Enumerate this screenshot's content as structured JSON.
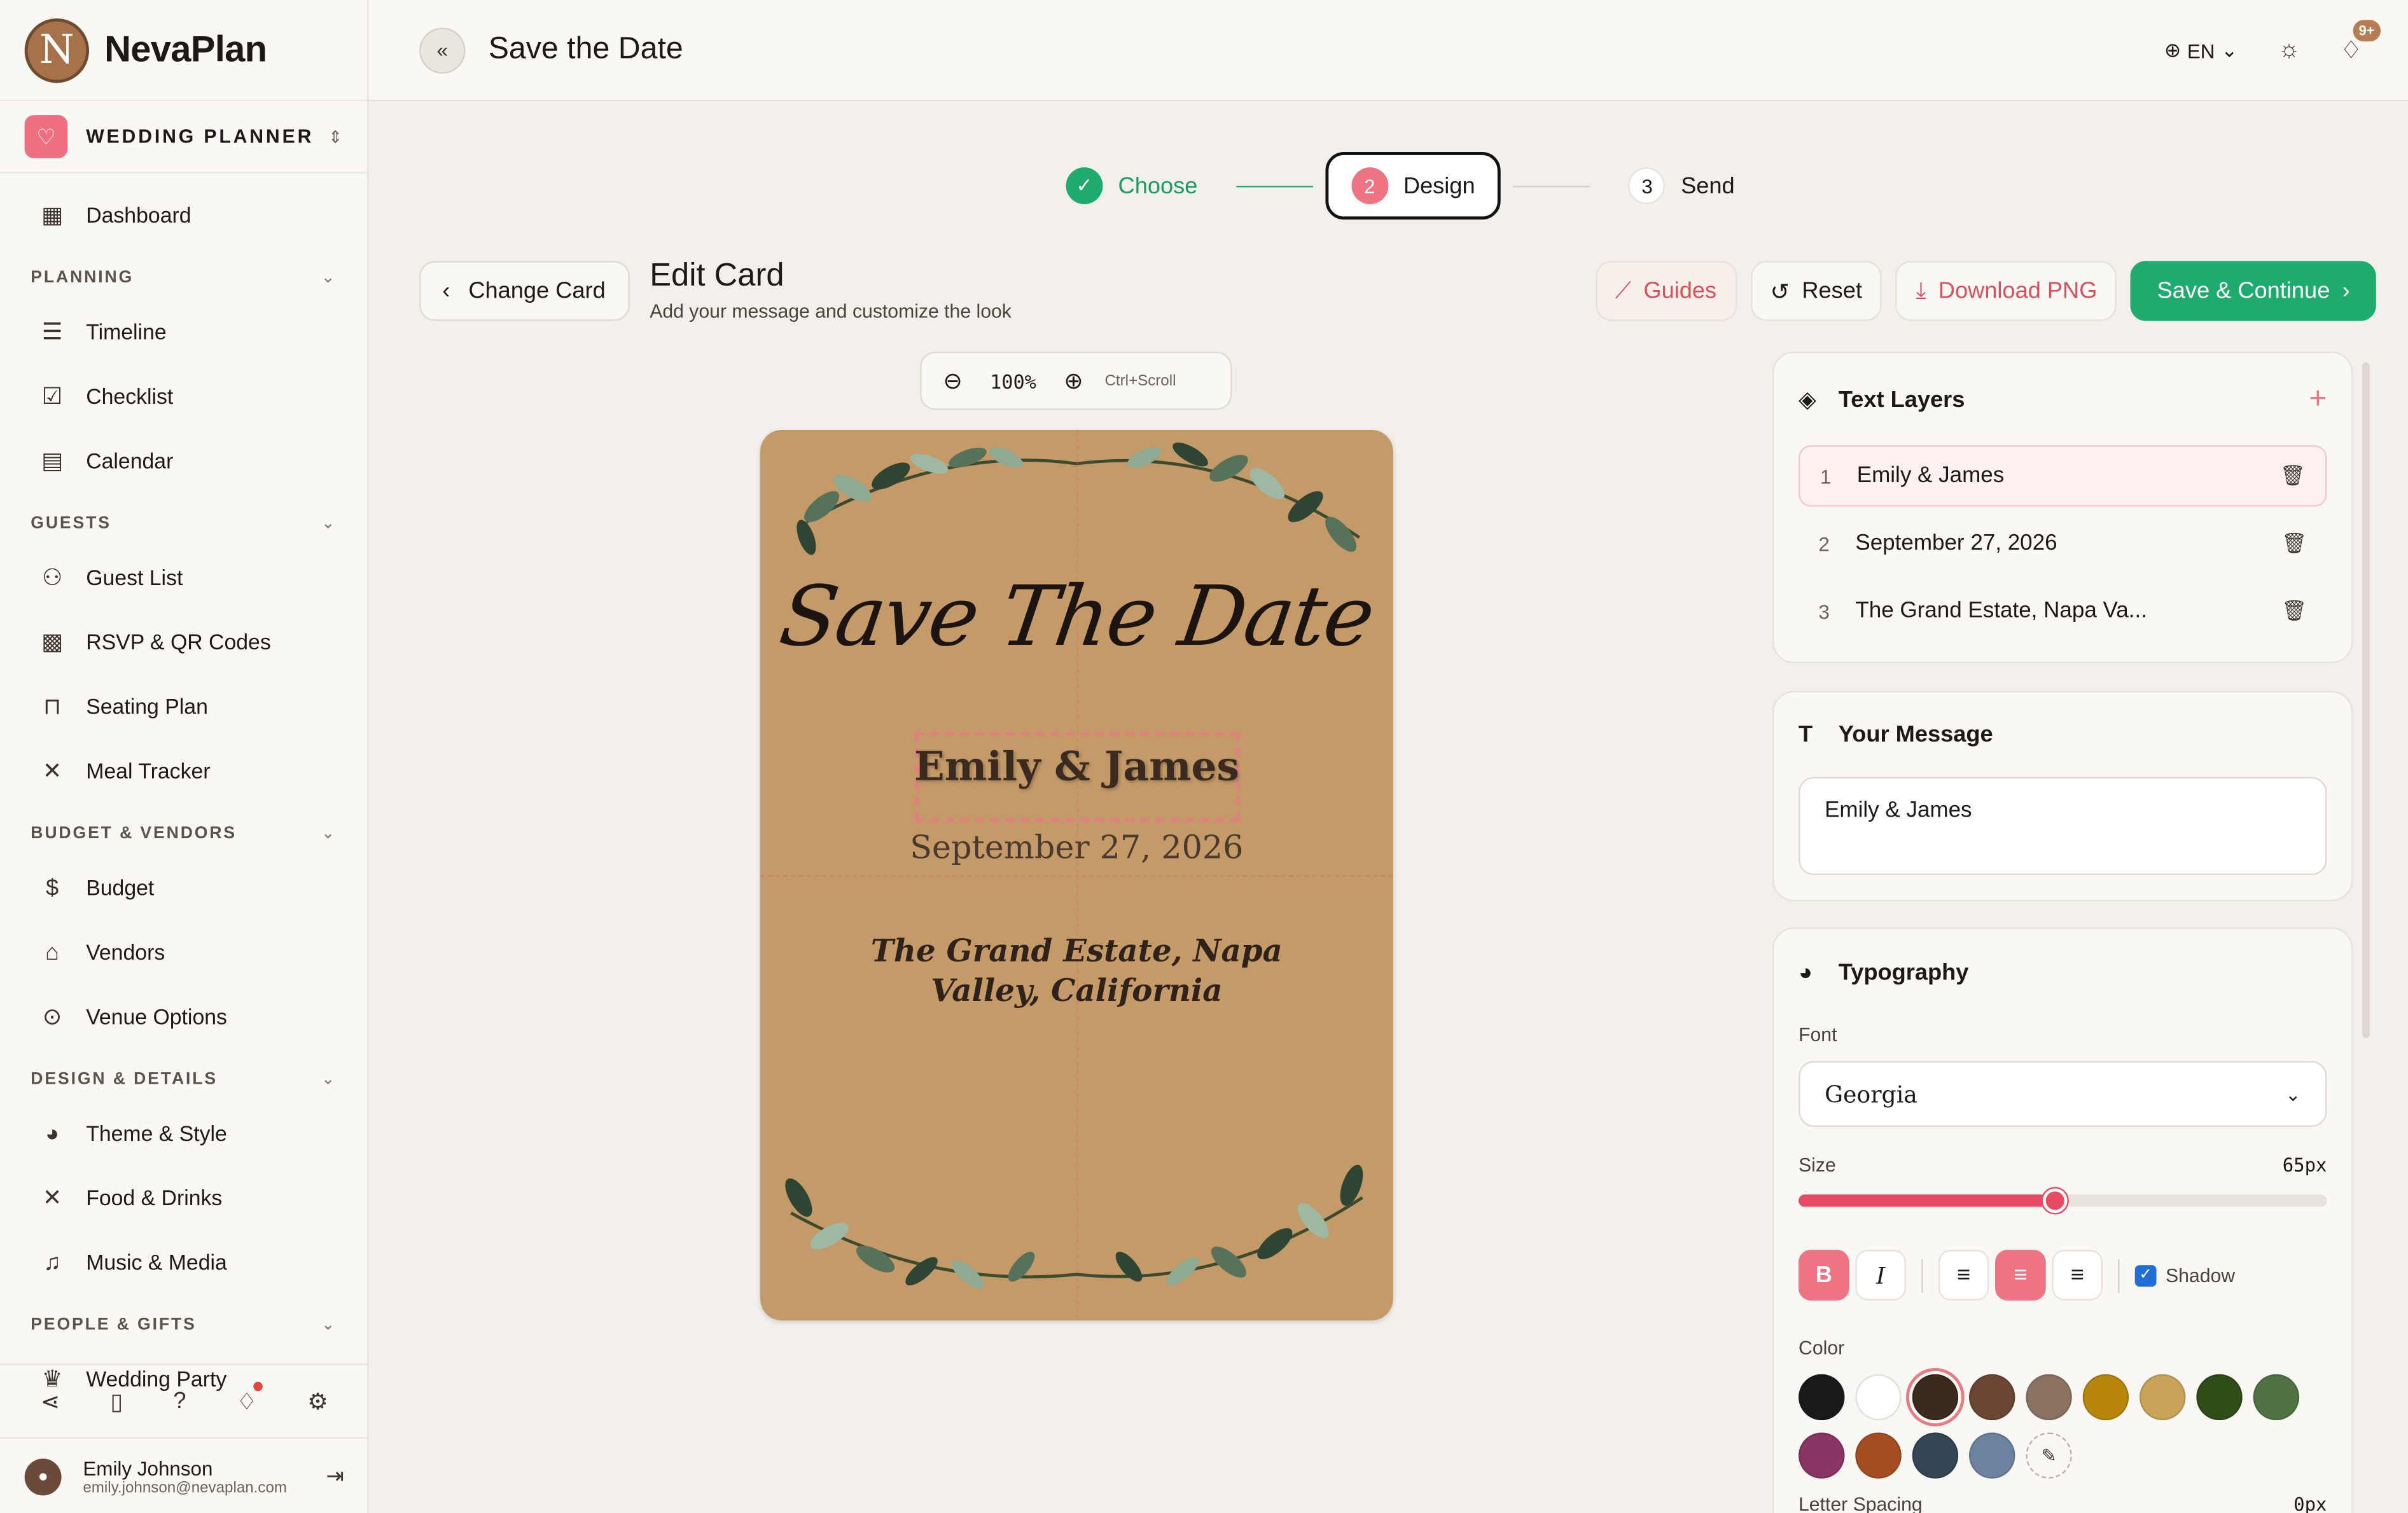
{
  "app": {
    "name": "NevaPlan",
    "planner": "WEDDING PLANNER"
  },
  "sidebar": {
    "dashboard": "Dashboard",
    "sections": [
      {
        "title": "PLANNING",
        "items": [
          "Timeline",
          "Checklist",
          "Calendar"
        ]
      },
      {
        "title": "GUESTS",
        "items": [
          "Guest List",
          "RSVP & QR Codes",
          "Seating Plan",
          "Meal Tracker"
        ]
      },
      {
        "title": "BUDGET & VENDORS",
        "items": [
          "Budget",
          "Vendors",
          "Venue Options"
        ]
      },
      {
        "title": "DESIGN & DETAILS",
        "items": [
          "Theme & Style",
          "Food & Drinks",
          "Music & Media"
        ]
      },
      {
        "title": "PEOPLE & GIFTS",
        "items": [
          "Wedding Party"
        ]
      }
    ],
    "icons": [
      "share-icon",
      "document-icon",
      "help-icon",
      "bell-icon",
      "gear-icon"
    ]
  },
  "user": {
    "name": "Emily Johnson",
    "email": "emily.johnson@nevaplan.com"
  },
  "topbar": {
    "title": "Save the Date",
    "lang": "EN",
    "notif_badge": "9+"
  },
  "stepper": [
    {
      "label": "Choose",
      "state": "done"
    },
    {
      "num": "2",
      "label": "Design",
      "state": "active"
    },
    {
      "num": "3",
      "label": "Send",
      "state": "pending"
    }
  ],
  "header": {
    "back": "Change Card",
    "title": "Edit Card",
    "subtitle": "Add your message and customize the look",
    "guides": "Guides",
    "reset": "Reset",
    "download": "Download PNG",
    "save": "Save & Continue"
  },
  "zoom": {
    "value": "100%",
    "hint": "Ctrl+Scroll"
  },
  "card": {
    "headline": "Save The Date",
    "names": "Emily & James",
    "date": "September 27, 2026",
    "venue": "The Grand Estate, Napa Valley, California"
  },
  "layers": {
    "title": "Text Layers",
    "items": [
      {
        "num": "1",
        "text": "Emily & James"
      },
      {
        "num": "2",
        "text": "September 27, 2026"
      },
      {
        "num": "3",
        "text": "The Grand Estate, Napa Va..."
      }
    ]
  },
  "message": {
    "title": "Your Message",
    "value": "Emily & James"
  },
  "typography": {
    "title": "Typography",
    "font_label": "Font",
    "font_value": "Georgia",
    "size_label": "Size",
    "size_value": "65px",
    "size_fraction": 0.485,
    "shadow_label": "Shadow",
    "color_label": "Color",
    "letter_spacing_label": "Letter Spacing",
    "letter_spacing_value": "0px",
    "colors": [
      "#1a1a1a",
      "#ffffff",
      "#3d2a1e",
      "#6b4634",
      "#8b7260",
      "#b8860b",
      "#c9a35a",
      "#2f4d17",
      "#4f7342",
      "#8b3466",
      "#a44e22",
      "#344556",
      "#6b83a0"
    ],
    "selected_color": "#3d2a1e"
  }
}
